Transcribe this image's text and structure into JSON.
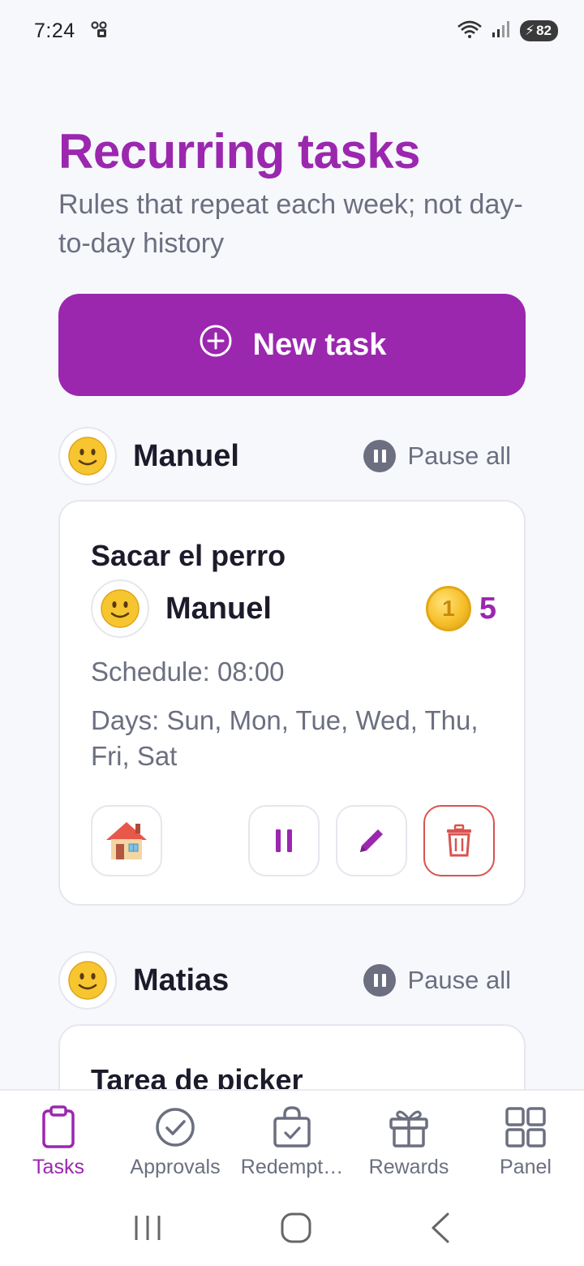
{
  "status_bar": {
    "time": "7:24",
    "battery": "82"
  },
  "header": {
    "title": "Recurring tasks",
    "subtitle": "Rules that repeat each week; not day-to-day history"
  },
  "new_task_button": {
    "label": "New task"
  },
  "groups": [
    {
      "name": "Manuel",
      "pause_label": "Pause all",
      "tasks": [
        {
          "title": "Sacar el perro",
          "assignee": "Manuel",
          "points": "5",
          "schedule": "Schedule: 08:00",
          "days": "Days: Sun, Mon, Tue, Wed, Thu, Fri, Sat"
        }
      ]
    },
    {
      "name": "Matias",
      "pause_label": "Pause all",
      "tasks": [
        {
          "title": "Tarea de picker"
        }
      ]
    }
  ],
  "bottom_nav": [
    {
      "label": "Tasks",
      "icon": "clipboard-icon",
      "active": true
    },
    {
      "label": "Approvals",
      "icon": "check-circle-icon",
      "active": false
    },
    {
      "label": "Redempt…",
      "icon": "bag-check-icon",
      "active": false
    },
    {
      "label": "Rewards",
      "icon": "gift-icon",
      "active": false
    },
    {
      "label": "Panel",
      "icon": "grid-icon",
      "active": false
    }
  ],
  "colors": {
    "accent": "#9b27af",
    "muted": "#6b6f80",
    "danger": "#d9534f",
    "background": "#f7f8fc"
  }
}
